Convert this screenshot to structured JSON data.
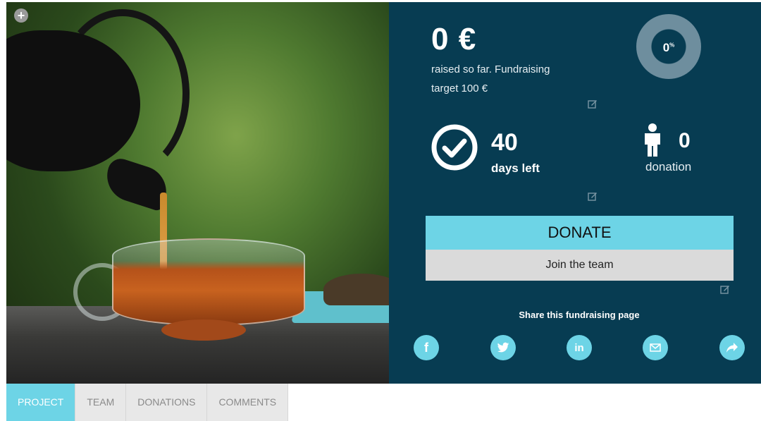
{
  "photo": {
    "alt": "Tea being poured from a cast iron teapot into a glass cup"
  },
  "stats": {
    "amount": "0 €",
    "raised_text": "raised so far. Fundraising target 100 €",
    "percent": "0",
    "percent_sign": "%",
    "days_number": "40",
    "days_label": "days left",
    "donations_number": "0",
    "donations_label": "donation"
  },
  "actions": {
    "donate_label": "DONATE",
    "join_label": "Join the team"
  },
  "share": {
    "title": "Share this fundraising page",
    "buttons": [
      {
        "icon": "facebook-icon",
        "glyph": "f"
      },
      {
        "icon": "twitter-icon",
        "glyph": "t"
      },
      {
        "icon": "linkedin-icon",
        "glyph": "in"
      },
      {
        "icon": "email-icon",
        "glyph": "✉"
      },
      {
        "icon": "share-icon",
        "glyph": "➦"
      }
    ]
  },
  "tabs": [
    {
      "label": "PROJECT",
      "active": true
    },
    {
      "label": "TEAM",
      "active": false
    },
    {
      "label": "DONATIONS",
      "active": false
    },
    {
      "label": "COMMENTS",
      "active": false
    }
  ],
  "colors": {
    "panel_bg": "#073c52",
    "accent": "#6dd4e6",
    "ring": "#6e8e9e"
  }
}
